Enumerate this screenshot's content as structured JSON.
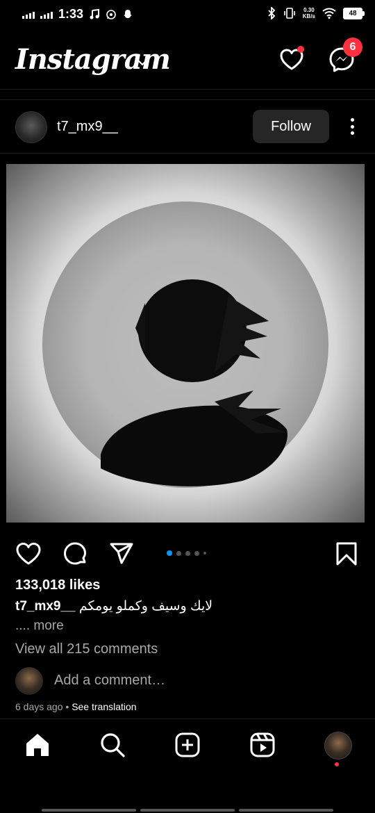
{
  "status_bar": {
    "time": "1:33",
    "net_speed_value": "0.30",
    "net_speed_unit": "KB/s",
    "battery": "48"
  },
  "app_bar": {
    "logo": "Instagram",
    "messages_badge": "6"
  },
  "post": {
    "username": "t7_mx9__",
    "follow_label": "Follow",
    "likes": "133,018 likes",
    "caption_user": "t7_mx9__",
    "caption_text": "لايك وسيف وكملو يومكم",
    "more_label": ".... more",
    "view_comments": "View all 215 comments",
    "comment_placeholder": "Add a comment…",
    "time_ago": "6 days ago",
    "separator": " • ",
    "see_translation": "See translation",
    "carousel_count": 5,
    "carousel_active": 1
  },
  "colors": {
    "accent_blue": "#0095f6",
    "notification_red": "#ff3040",
    "background": "#000000",
    "follow_button": "#262626"
  },
  "icons": {
    "like": "heart-icon",
    "comment": "comment-icon",
    "share": "send-icon",
    "save": "bookmark-icon",
    "home": "home-icon",
    "search": "search-icon",
    "create": "add-icon",
    "reels": "reels-icon",
    "activity": "heart-icon",
    "messages": "messenger-icon"
  }
}
